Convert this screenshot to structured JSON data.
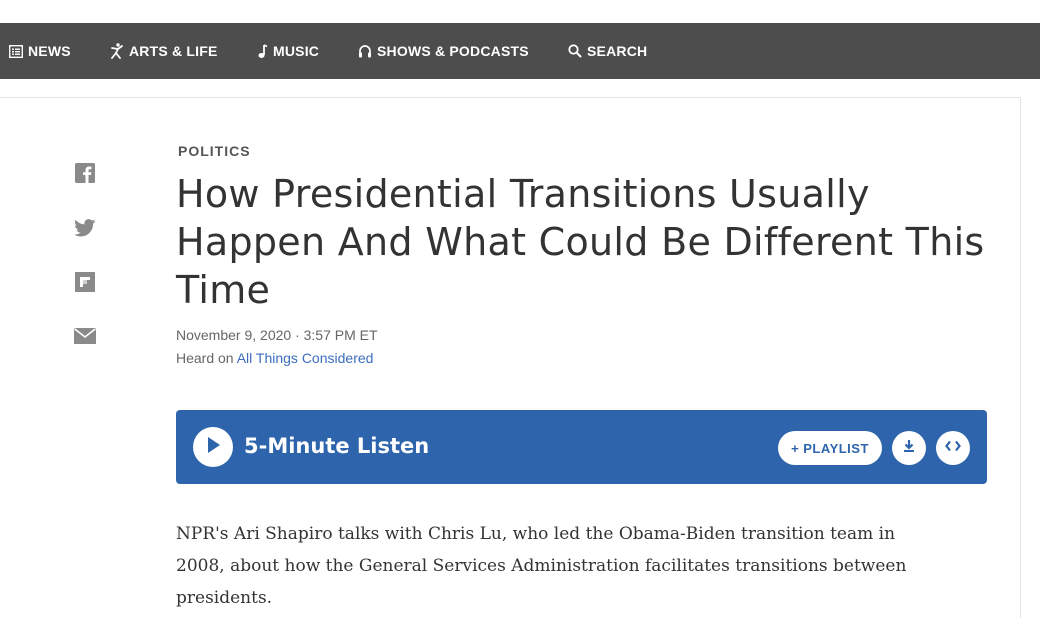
{
  "nav": {
    "news": "NEWS",
    "arts": "ARTS & LIFE",
    "music": "MUSIC",
    "shows": "SHOWS & PODCASTS",
    "search": "SEARCH"
  },
  "article": {
    "slug": "POLITICS",
    "headline": "How Presidential Transitions Usually Happen And What Could Be Different This Time",
    "dateline": "November 9, 2020 · 3:57 PM ET",
    "heard_prefix": "Heard on ",
    "heard_program": "All Things Considered",
    "body": "NPR's Ari Shapiro talks with Chris Lu, who led the Obama-Biden transition team in 2008, about how the General Services Administration facilitates transitions between presidents."
  },
  "player": {
    "label": "5-Minute Listen",
    "playlist": "+ PLAYLIST",
    "color": "#2d64ac"
  },
  "share_icons": [
    "facebook-icon",
    "twitter-icon",
    "flipboard-icon",
    "email-icon"
  ],
  "colors": {
    "navbar": "#4d4d4d",
    "link": "#3b6ec1"
  }
}
